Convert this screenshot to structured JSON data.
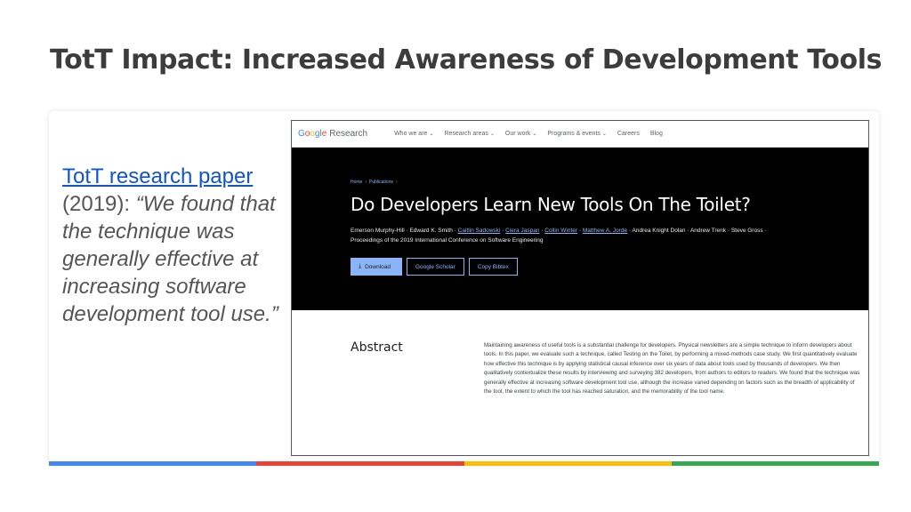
{
  "slide": {
    "title": "TotT Impact: Increased Awareness of Development Tools",
    "colors": [
      "#4285f4",
      "#ea4335",
      "#fbbc05",
      "#34a853"
    ]
  },
  "quote": {
    "link_text": "TotT research paper",
    "year": "(2019):",
    "text": "“We found that the technique was generally effective at increasing software development tool use.”"
  },
  "site": {
    "logo": {
      "letters": [
        "G",
        "o",
        "o",
        "g",
        "l",
        "e"
      ],
      "product": "Research"
    },
    "nav": [
      {
        "label": "Who we are",
        "dropdown": true
      },
      {
        "label": "Research areas",
        "dropdown": true
      },
      {
        "label": "Our work",
        "dropdown": true
      },
      {
        "label": "Programs & events",
        "dropdown": true
      },
      {
        "label": "Careers",
        "dropdown": false
      },
      {
        "label": "Blog",
        "dropdown": false
      }
    ]
  },
  "paper": {
    "breadcrumbs": [
      "Home",
      "Publications"
    ],
    "title": "Do Developers Learn New Tools On The Toilet?",
    "authors": [
      {
        "name": "Emerson Murphy-Hill",
        "link": false
      },
      {
        "name": "Edward K. Smith",
        "link": false
      },
      {
        "name": "Caitlin Sadowski",
        "link": true
      },
      {
        "name": "Ciera Jaspan",
        "link": true
      },
      {
        "name": "Collin Winter",
        "link": true
      },
      {
        "name": "Matthew A. Jorde",
        "link": true
      },
      {
        "name": "Andrea Knight Dolan",
        "link": false
      },
      {
        "name": "Andrew Trenk",
        "link": false
      },
      {
        "name": "Steve Gross",
        "link": false
      }
    ],
    "venue": "Proceedings of the 2019 International Conference on Software Engineering",
    "buttons": {
      "download": "Download",
      "scholar": "Google Scholar",
      "bibtex": "Copy Bibtex"
    },
    "abstract_heading": "Abstract",
    "abstract": "Maintaining awareness of useful tools is a substantial challenge for developers. Physical newsletters are a simple technique to inform developers about tools. In this paper, we evaluate such a technique, called Testing on the Toilet, by performing a mixed-methods case study. We first quantitatively evaluate how effective this technique is by applying statistical causal inference over six years of data about tools used by thousands of developers. We then qualitatively contextualize these results by interviewing and surveying 382 developers, from authors to editors to readers. We found that the technique was generally effective at increasing software development tool use, although the increase varied depending on factors such as the breadth of applicability of the tool, the extent to which the tool has reached saturation, and the memorability of the tool name."
  }
}
